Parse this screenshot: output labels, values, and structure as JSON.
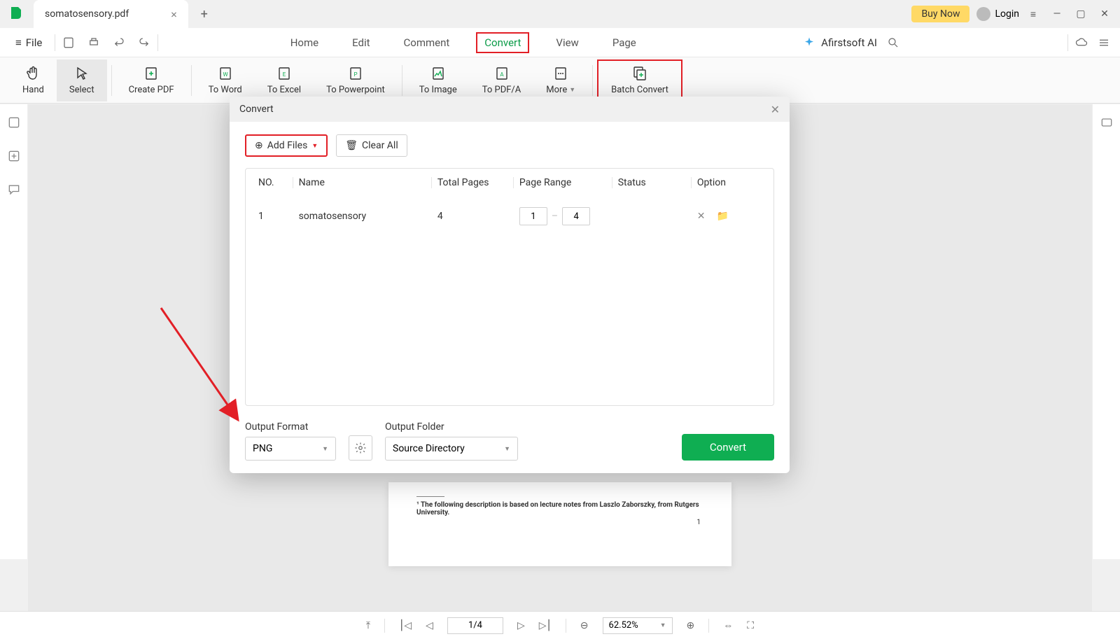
{
  "titlebar": {
    "tab_title": "somatosensory.pdf",
    "buy_now": "Buy Now",
    "login": "Login"
  },
  "menubar": {
    "file": "File",
    "tabs": {
      "home": "Home",
      "edit": "Edit",
      "comment": "Comment",
      "convert": "Convert",
      "view": "View",
      "page": "Page"
    },
    "ai": "Afirstsoft AI"
  },
  "toolbar": {
    "hand": "Hand",
    "select": "Select",
    "create_pdf": "Create PDF",
    "to_word": "To Word",
    "to_excel": "To Excel",
    "to_ppt": "To Powerpoint",
    "to_image": "To Image",
    "to_pdfa": "To PDF/A",
    "more": "More",
    "batch": "Batch Convert"
  },
  "dialog": {
    "title": "Convert",
    "add_files": "Add Files",
    "clear_all": "Clear All",
    "headers": {
      "no": "NO.",
      "name": "Name",
      "pages": "Total Pages",
      "range": "Page Range",
      "status": "Status",
      "option": "Option"
    },
    "row": {
      "no": "1",
      "name": "somatosensory",
      "pages": "4",
      "from": "1",
      "to": "4"
    },
    "output_format_label": "Output Format",
    "output_format": "PNG",
    "output_folder_label": "Output Folder",
    "output_folder": "Source Directory",
    "convert": "Convert"
  },
  "doc": {
    "footnote": "¹ The following description is based on lecture notes from Laszlo Zaborszky, from Rutgers University.",
    "pagenum": "1"
  },
  "statusbar": {
    "page": "1/4",
    "zoom": "62.52%"
  }
}
